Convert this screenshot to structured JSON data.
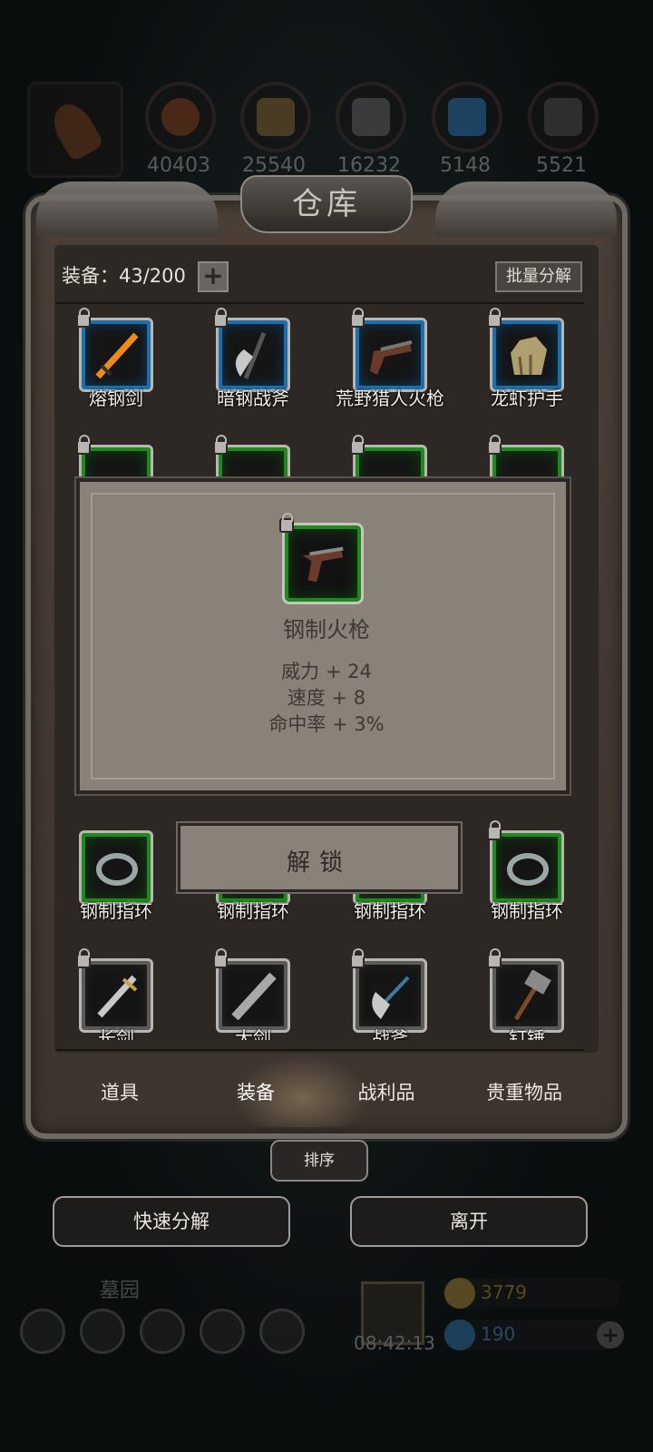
{
  "resources": [
    {
      "icon": "horn-icon",
      "value": ""
    },
    {
      "icon": "leather-icon",
      "value": "40403"
    },
    {
      "icon": "wood-icon",
      "value": "25540"
    },
    {
      "icon": "iron-icon",
      "value": "16232"
    },
    {
      "icon": "crystal-icon",
      "value": "5148"
    },
    {
      "icon": "stone-icon",
      "value": "5521"
    }
  ],
  "title": "仓库",
  "equip_count": "装备：43/200",
  "plus_label": "+",
  "batch_label": "批量分解",
  "items": {
    "row1": [
      {
        "name": "熔钢剑",
        "rarity": "blue",
        "icon": "sword-icon"
      },
      {
        "name": "暗钢战斧",
        "rarity": "blue",
        "icon": "axe-icon"
      },
      {
        "name": "荒野猎人火枪",
        "rarity": "blue",
        "icon": "musket-icon"
      },
      {
        "name": "龙虾护手",
        "rarity": "blue",
        "icon": "gauntlet-icon"
      }
    ],
    "row4": [
      {
        "name": "钢制指环",
        "rarity": "green",
        "icon": "ring-icon"
      },
      {
        "name": "钢制指环",
        "rarity": "green",
        "icon": "ring-icon"
      },
      {
        "name": "钢制指环",
        "rarity": "green",
        "icon": "ring-icon"
      },
      {
        "name": "钢制指环",
        "rarity": "green",
        "icon": "ring-icon"
      }
    ],
    "row5": [
      {
        "name": "长剑",
        "rarity": "gray",
        "icon": "longsword-icon"
      },
      {
        "name": "大剑",
        "rarity": "gray",
        "icon": "greatsword-icon"
      },
      {
        "name": "战斧",
        "rarity": "gray",
        "icon": "battleaxe-icon"
      },
      {
        "name": "钉锤",
        "rarity": "gray",
        "icon": "mace-icon"
      }
    ]
  },
  "tooltip": {
    "name": "钢制火枪",
    "icon": "pistol-icon",
    "stats": [
      "威力 + 24",
      "速度 + 8",
      "命中率 + 3%"
    ]
  },
  "unlock_label": "解锁",
  "tabs": [
    {
      "label": "道具",
      "active": false
    },
    {
      "label": "装备",
      "active": true
    },
    {
      "label": "战利品",
      "active": false
    },
    {
      "label": "贵重物品",
      "active": false
    }
  ],
  "sort_label": "排序",
  "quick_decompose_label": "快速分解",
  "leave_label": "离开",
  "hud": {
    "location": "墓园",
    "timer": "08:42:13",
    "gold": "3779",
    "gems": "190"
  },
  "colors": {
    "blue_rarity": "#1a6fae",
    "green_rarity": "#1e8a1e",
    "gray_rarity": "#5a5a5a",
    "gold": "#c8a040",
    "gem": "#3a8ac8"
  }
}
